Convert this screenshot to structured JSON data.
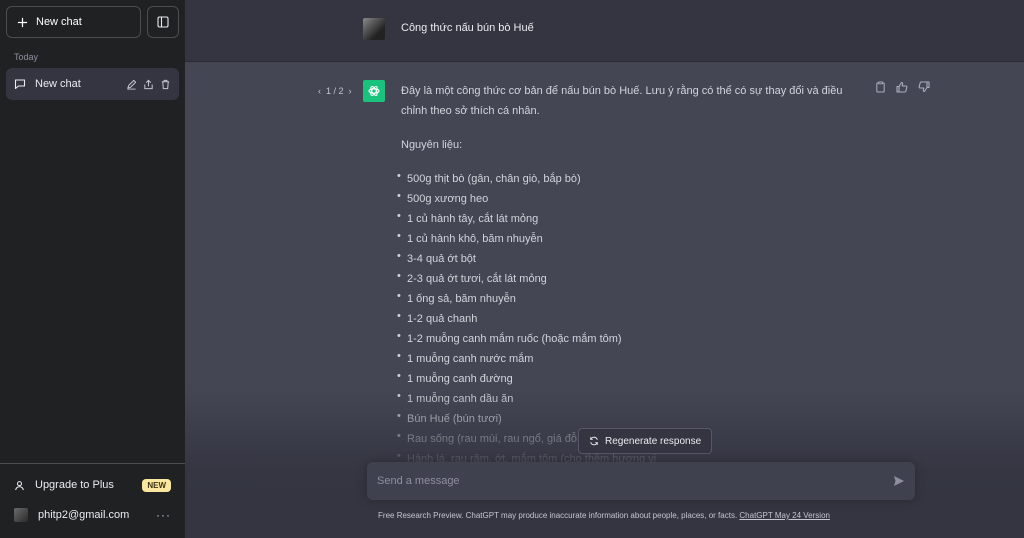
{
  "sidebar": {
    "new_chat_label": "New chat",
    "section_label": "Today",
    "history": [
      {
        "label": "New chat"
      }
    ],
    "upgrade_label": "Upgrade to Plus",
    "new_badge": "NEW",
    "user_email": "phitp2@gmail.com",
    "more_label": "···"
  },
  "conversation": {
    "user_message": "Công thức nấu bún bò Huế",
    "pager": {
      "prev": "‹",
      "value": "1 / 2",
      "next": "›"
    },
    "response_intro": "Đây là một công thức cơ bản để nấu bún bò Huế. Lưu ý rằng có thể có sự thay đổi và điều chỉnh theo sở thích cá nhân.",
    "ingredients_heading": "Nguyên liệu:",
    "ingredients": [
      "500g thịt bò (gân, chân giò, bắp bò)",
      "500g xương heo",
      "1 củ hành tây, cắt lát mỏng",
      "1 củ hành khô, băm nhuyễn",
      "3-4 quả ớt bột",
      "2-3 quả ớt tươi, cắt lát mỏng",
      "1 ống sả, băm nhuyễn",
      "1-2 quả chanh",
      "1-2 muỗng canh mắm ruốc (hoặc mắm tôm)",
      "1 muỗng canh nước mắm",
      "1 muỗng canh đường",
      "1 muỗng canh dầu ăn",
      "Bún Huế (bún tươi)",
      "Rau sống (rau mùi, rau ngổ, giá đỗ",
      "Hành lá, rau răm, ớt, mắm tôm (cho thêm hương vị"
    ]
  },
  "regenerate_label": "Regenerate response",
  "input": {
    "placeholder": "Send a message",
    "value": ""
  },
  "footer": {
    "text": "Free Research Preview. ChatGPT may produce inaccurate information about people, places, or facts.",
    "link": "ChatGPT May 24 Version"
  },
  "icons": {
    "plus": "plus-icon",
    "sidebar_toggle": "sidebar-toggle-icon",
    "chat": "message-icon",
    "edit": "pencil-icon",
    "share": "share-icon",
    "delete": "trash-icon",
    "user": "user-icon",
    "copy": "clipboard-icon",
    "thumbs_up": "thumbs-up-icon",
    "thumbs_down": "thumbs-down-icon",
    "regenerate": "refresh-icon",
    "send": "send-icon"
  },
  "colors": {
    "sidebar_bg": "#202123",
    "main_bg": "#343541",
    "assistant_bg": "#444654",
    "accent": "#19c37d",
    "badge": "#fae69e"
  }
}
